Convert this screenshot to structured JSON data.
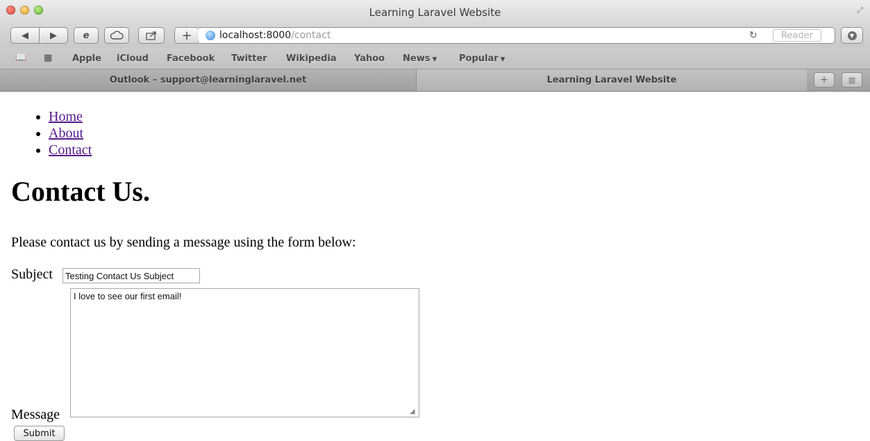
{
  "window": {
    "title": "Learning Laravel Website"
  },
  "toolbar": {
    "url_host": "localhost:8000",
    "url_path": "/contact",
    "reader_label": "Reader"
  },
  "bookmarks": {
    "items": [
      {
        "label": "Apple"
      },
      {
        "label": "iCloud"
      },
      {
        "label": "Facebook"
      },
      {
        "label": "Twitter"
      },
      {
        "label": "Wikipedia"
      },
      {
        "label": "Yahoo"
      },
      {
        "label": "News"
      },
      {
        "label": "Popular"
      }
    ]
  },
  "tabs": [
    {
      "label": "Outlook – support@learninglaravel.net",
      "active": false
    },
    {
      "label": "Learning Laravel Website",
      "active": true
    }
  ],
  "nav": {
    "items": [
      {
        "label": "Home"
      },
      {
        "label": "About"
      },
      {
        "label": "Contact"
      }
    ]
  },
  "page": {
    "title": "Contact Us.",
    "intro": "Please contact us by sending a message using the form below:"
  },
  "form": {
    "subject_label": "Subject",
    "subject_value": "Testing Contact Us Subject",
    "message_label": "Message",
    "message_value": "I love to see our first email!",
    "submit_label": "Submit"
  },
  "icons": {
    "back": "chevron-left-icon",
    "forward": "chevron-right-icon",
    "ie": "ie-icon",
    "cloud": "cloud-icon",
    "share": "share-icon",
    "add": "plus-icon",
    "globe": "globe-icon",
    "reload": "reload-icon",
    "download": "download-icon",
    "bookmarks": "book-icon",
    "top_sites": "grid-icon",
    "new_tab": "plus-icon",
    "tab_overview": "tab-overview-icon"
  },
  "colors": {
    "link": "#551a8b",
    "close_light": "#e0443a",
    "minimize_light": "#e6a522",
    "maximize_light": "#5dbb2e"
  }
}
